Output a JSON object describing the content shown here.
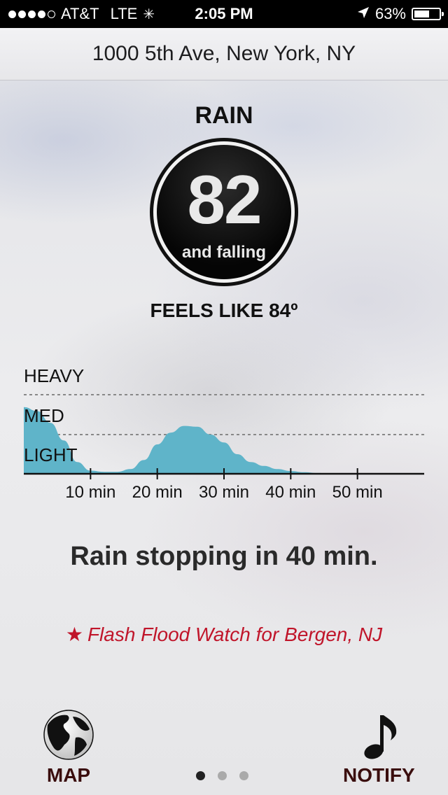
{
  "status_bar": {
    "signal_dots_filled": 4,
    "signal_dots_total": 5,
    "carrier": "AT&T",
    "network": "LTE",
    "time": "2:05 PM",
    "battery_percent": "63%",
    "battery_level": 0.63
  },
  "header": {
    "location": "1000 5th Ave, New York, NY"
  },
  "current": {
    "condition": "RAIN",
    "temperature": "82",
    "trend": "and falling",
    "feels_like": "FEELS LIKE 84º"
  },
  "chart_data": {
    "type": "area",
    "y_levels": [
      "HEAVY",
      "MED",
      "LIGHT"
    ],
    "x_ticks": [
      "10 min",
      "20 min",
      "30 min",
      "40 min",
      "50 min"
    ],
    "x": [
      0,
      2,
      4,
      6,
      8,
      10,
      12,
      14,
      16,
      18,
      20,
      22,
      24,
      26,
      28,
      30,
      32,
      34,
      36,
      38,
      40,
      42,
      44,
      46,
      48,
      50,
      52,
      54,
      56,
      58,
      60
    ],
    "intensity": [
      1.7,
      1.6,
      1.3,
      0.85,
      0.3,
      0.08,
      0.05,
      0.05,
      0.12,
      0.35,
      0.75,
      1.05,
      1.22,
      1.2,
      1.0,
      0.8,
      0.5,
      0.3,
      0.2,
      0.12,
      0.07,
      0.04,
      0.02,
      0.01,
      0.01,
      0,
      0,
      0,
      0,
      0,
      0
    ],
    "xlim": [
      0,
      60
    ],
    "ylim": [
      0,
      3
    ],
    "color": "#5fb4c9"
  },
  "summary": "Rain stopping in 40 min.",
  "alert": {
    "star": "★",
    "text": "Flash Flood Watch for Bergen, NJ",
    "color": "#c0152a"
  },
  "bottom": {
    "map_label": "MAP",
    "notify_label": "NOTIFY",
    "pages": 3,
    "active_page": 1
  }
}
